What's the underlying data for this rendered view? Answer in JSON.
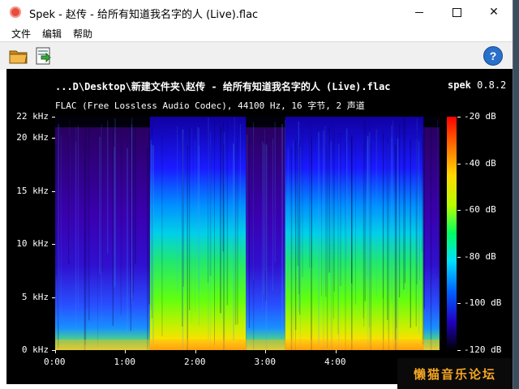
{
  "window": {
    "title": "Spek - 赵传 - 给所有知道我名字的人 (Live).flac",
    "controls": {
      "minimize": "minimize",
      "maximize": "maximize",
      "close": "✕"
    }
  },
  "menu": {
    "items": [
      {
        "label": "文件"
      },
      {
        "label": "编辑"
      },
      {
        "label": "帮助"
      }
    ]
  },
  "toolbar": {
    "open_icon": "folder-open-icon",
    "save_icon": "save-image-icon",
    "help_icon": "help-icon",
    "help_glyph": "?"
  },
  "spek": {
    "file_header": "...D\\Desktop\\新建文件夹\\赵传 - 给所有知道我名字的人 (Live).flac",
    "app_name": "spek",
    "version": "0.8.2",
    "info": "FLAC (Free Lossless Audio Codec), 44100 Hz, 16 字节, 2 声道"
  },
  "chart_data": {
    "type": "heatmap",
    "title": "",
    "xlabel": "",
    "ylabel": "",
    "x_ticks": [
      "0:00",
      "1:00",
      "2:00",
      "3:00",
      "4:00"
    ],
    "y_ticks": [
      "0 kHz",
      "5 kHz",
      "10 kHz",
      "15 kHz",
      "20 kHz",
      "22 kHz"
    ],
    "y_tick_values_khz": [
      0,
      5,
      10,
      15,
      20,
      22
    ],
    "ylim_khz": [
      0,
      22
    ],
    "colorbar_ticks": [
      "-20 dB",
      "-40 dB",
      "-60 dB",
      "-80 dB",
      "-100 dB",
      "-120 dB"
    ],
    "colorbar_values_db": [
      -20,
      -40,
      -60,
      -80,
      -100,
      -120
    ],
    "colorbar_range_db": [
      -120,
      -20
    ],
    "duration_minutes": 5.48,
    "segments_minutes": [
      {
        "start": 0.0,
        "end": 1.35,
        "level": "low"
      },
      {
        "start": 1.35,
        "end": 2.72,
        "level": "high"
      },
      {
        "start": 2.72,
        "end": 3.28,
        "level": "low"
      },
      {
        "start": 3.28,
        "end": 5.25,
        "level": "high"
      },
      {
        "start": 5.25,
        "end": 5.48,
        "level": "low"
      }
    ]
  },
  "watermark": "懒猫音乐论坛"
}
